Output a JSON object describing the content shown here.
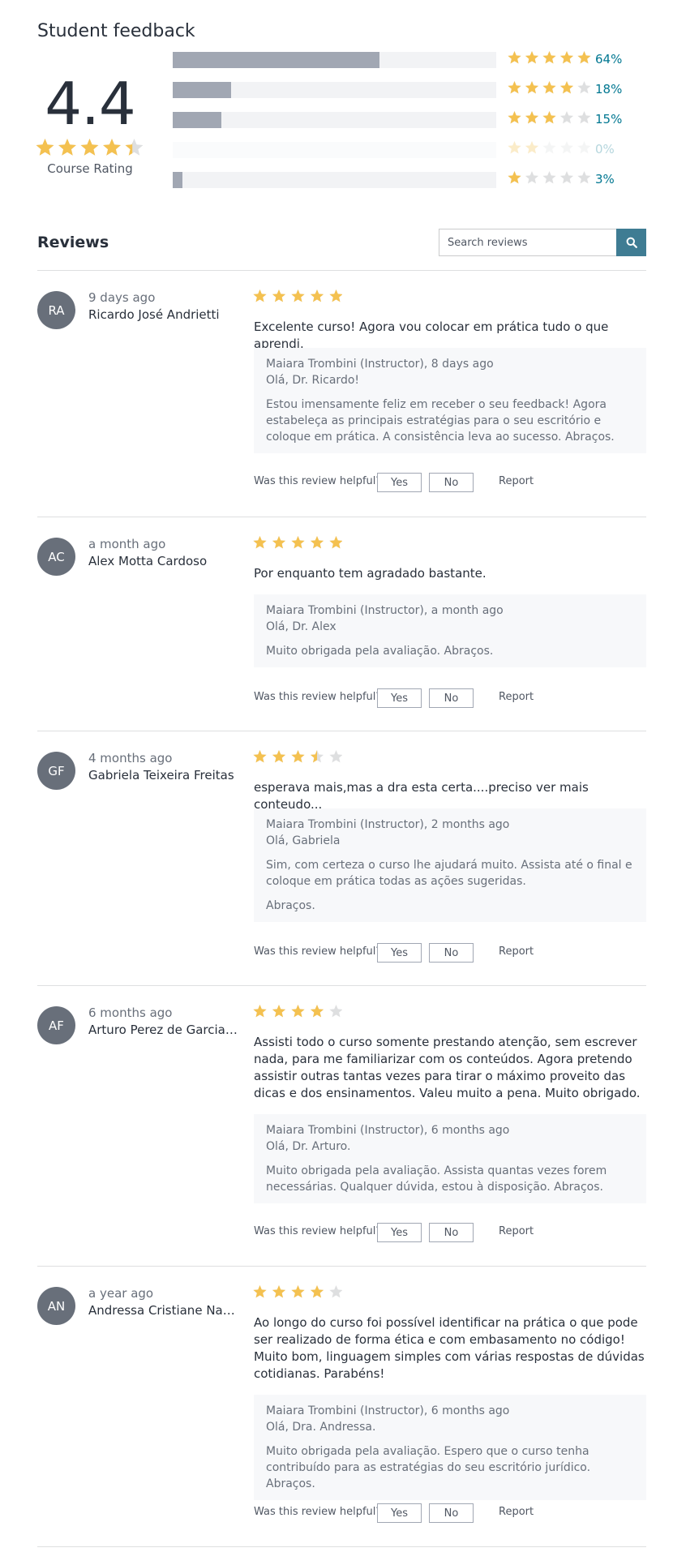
{
  "feedback": {
    "title": "Student feedback",
    "average": "4.4",
    "average_stars": 4.4,
    "course_rating_label": "Course Rating",
    "distribution": [
      {
        "stars": 5,
        "percent": 64,
        "label": "64%"
      },
      {
        "stars": 4,
        "percent": 18,
        "label": "18%"
      },
      {
        "stars": 3,
        "percent": 15,
        "label": "15%"
      },
      {
        "stars": 2,
        "percent": 0,
        "label": "0%"
      },
      {
        "stars": 1,
        "percent": 3,
        "label": "3%"
      }
    ]
  },
  "reviews_header": {
    "title": "Reviews",
    "search_placeholder": "Search reviews",
    "search_icon": "search-icon"
  },
  "helpful_question": "Was this review helpful?",
  "yes_label": "Yes",
  "no_label": "No",
  "report_label": "Report",
  "colors": {
    "star": "#f4c150",
    "star_empty": "#dedfe0",
    "bar_fill": "#a1a7b3",
    "bar_bg": "#f2f3f5",
    "accent": "#007791",
    "search_button": "#3f7c93",
    "avatar": "#686f7a"
  },
  "reviews": [
    {
      "initials": "RA",
      "time": "9 days ago",
      "name": "Ricardo José Andrietti",
      "rating": 5,
      "text": "Excelente curso! Agora vou colocar em prática tudo o que aprendi.",
      "reply": {
        "author": "Maiara Trombini (Instructor), 8 days ago",
        "greeting": "Olá, Dr. Ricardo!",
        "paragraphs": [
          "Estou imensamente feliz em receber o seu feedback! Agora estabeleça as principais estratégias para o seu escritório e coloque em prática. A consistência leva ao sucesso. Abraços."
        ]
      }
    },
    {
      "initials": "AC",
      "time": "a month ago",
      "name": "Alex Motta Cardoso",
      "rating": 5,
      "text": "Por enquanto tem agradado bastante.",
      "reply": {
        "author": "Maiara Trombini (Instructor), a month ago",
        "greeting": "Olá, Dr. Alex",
        "paragraphs": [
          "Muito obrigada pela avaliação. Abraços."
        ]
      }
    },
    {
      "initials": "GF",
      "time": "4 months ago",
      "name": "Gabriela Teixeira Freitas",
      "rating": 3.5,
      "text": "esperava mais,mas a dra esta certa....preciso ver mais conteudo...",
      "reply": {
        "author": "Maiara Trombini (Instructor), 2 months ago",
        "greeting": "Olá, Gabriela",
        "paragraphs": [
          "Sim, com certeza o curso lhe ajudará muito. Assista até o final e coloque em prática todas as ações sugeridas.",
          "Abraços."
        ]
      }
    },
    {
      "initials": "AF",
      "time": "6 months ago",
      "name": "Arturo Perez de Garcia Fernandes",
      "rating": 4,
      "text": "Assisti todo o curso somente prestando atenção, sem escrever nada, para me familiarizar com os conteúdos. Agora pretendo assistir outras tantas vezes para tirar o máximo proveito das dicas e dos ensinamentos. Valeu muito a pena. Muito obrigado.",
      "reply": {
        "author": "Maiara Trombini (Instructor), 6 months ago",
        "greeting": "Olá, Dr. Arturo.",
        "paragraphs": [
          "Muito obrigada pela avaliação. Assista quantas vezes forem necessárias. Qualquer dúvida, estou à disposição. Abraços."
        ]
      }
    },
    {
      "initials": "AN",
      "time": "a year ago",
      "name": "Andressa Cristiane Nagildo",
      "rating": 4,
      "text": "Ao longo do curso foi possível identificar na prática o que pode ser realizado de forma ética e com embasamento no código! Muito bom, linguagem simples com várias respostas de dúvidas cotidianas. Parabéns!",
      "reply": {
        "author": "Maiara Trombini (Instructor), 6 months ago",
        "greeting": "Olá, Dra. Andressa.",
        "paragraphs": [
          "Muito obrigada pela avaliação. Espero que o curso tenha contribuído para as estratégias do seu escritório jurídico. Abraços."
        ]
      }
    }
  ]
}
